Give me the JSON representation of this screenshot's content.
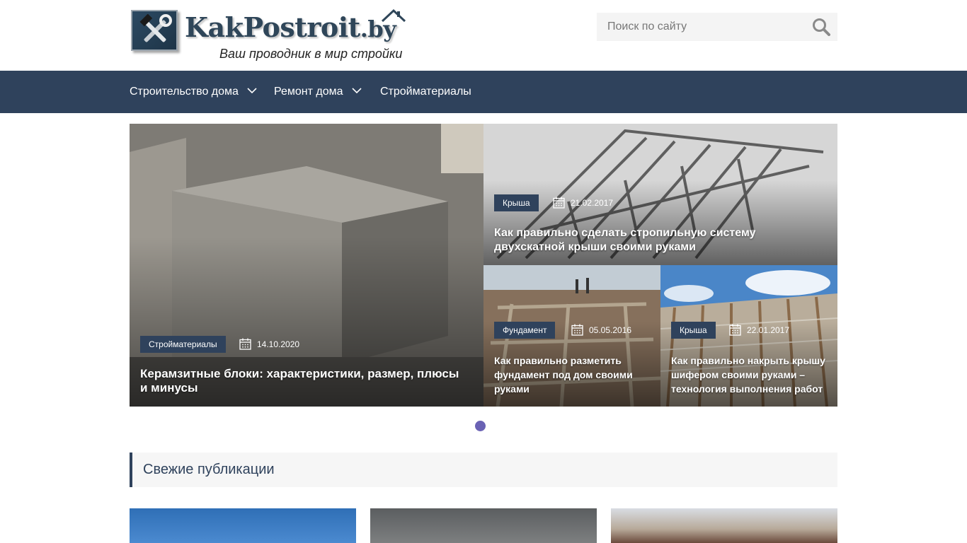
{
  "header": {
    "logo": {
      "name": "KakPostroit",
      "tld": ".by",
      "tagline": "Ваш проводник в мир стройки",
      "icon": "tools-icon"
    },
    "search": {
      "placeholder": "Поиск по сайту",
      "value": "",
      "icon": "search-icon"
    }
  },
  "nav": {
    "items": [
      {
        "label": "Строительство дома",
        "has_dropdown": true
      },
      {
        "label": "Ремонт дома",
        "has_dropdown": true
      },
      {
        "label": "Стройматериалы",
        "has_dropdown": false
      }
    ]
  },
  "slider": {
    "cards": [
      {
        "category": "Стройматериалы",
        "date": "14.10.2020",
        "title": "Керамзитные блоки: характеристики, размер, плюсы и минусы"
      },
      {
        "category": "Крыша",
        "date": "21.02.2017",
        "title": "Как правильно сделать стропильную систему двухскатной крыши своими руками"
      },
      {
        "category": "Фундамент",
        "date": "05.05.2016",
        "title": "Как правильно разметить фундамент под дом своими руками"
      },
      {
        "category": "Крыша",
        "date": "22.01.2017",
        "title": "Как правильно накрыть крышу шифером своими руками – технология выполнения работ"
      }
    ],
    "active_dot": 1,
    "dot_color": "#6a62b4"
  },
  "sections": {
    "fresh_title": "Свежие публикации"
  },
  "colors": {
    "nav_bg": "#2f425c",
    "badge_bg": "#2f425c",
    "search_bg": "#f4f4f4"
  }
}
